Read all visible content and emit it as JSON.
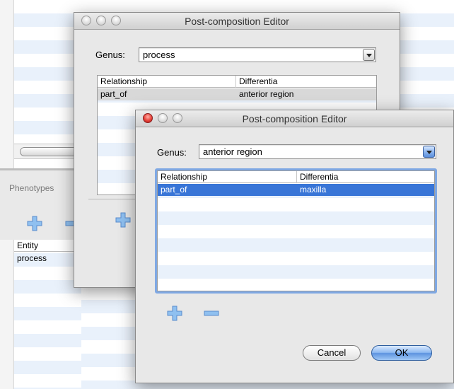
{
  "background": {
    "phenotypes_label": "Phenotypes",
    "table": {
      "header": "Entity",
      "rows": [
        "process"
      ]
    }
  },
  "back_window": {
    "title": "Post-composition Editor",
    "genus_label": "Genus:",
    "genus_value": "process",
    "table": {
      "columns": [
        "Relationship",
        "Differentia"
      ],
      "rows": [
        {
          "relationship": "part_of",
          "differentia": "anterior region"
        }
      ]
    }
  },
  "front_window": {
    "title": "Post-composition Editor",
    "genus_label": "Genus:",
    "genus_value": "anterior region",
    "table": {
      "columns": [
        "Relationship",
        "Differentia"
      ],
      "rows": [
        {
          "relationship": "part_of",
          "differentia": "maxilla"
        }
      ]
    },
    "cancel_label": "Cancel",
    "ok_label": "OK"
  },
  "colors": {
    "selection": "#3875d7",
    "stripe": "#e9f1fb",
    "add_icon": "#5a9be0",
    "close_button": "#e8423a"
  },
  "icons": {
    "add": "plus-icon",
    "remove": "minus-icon"
  }
}
